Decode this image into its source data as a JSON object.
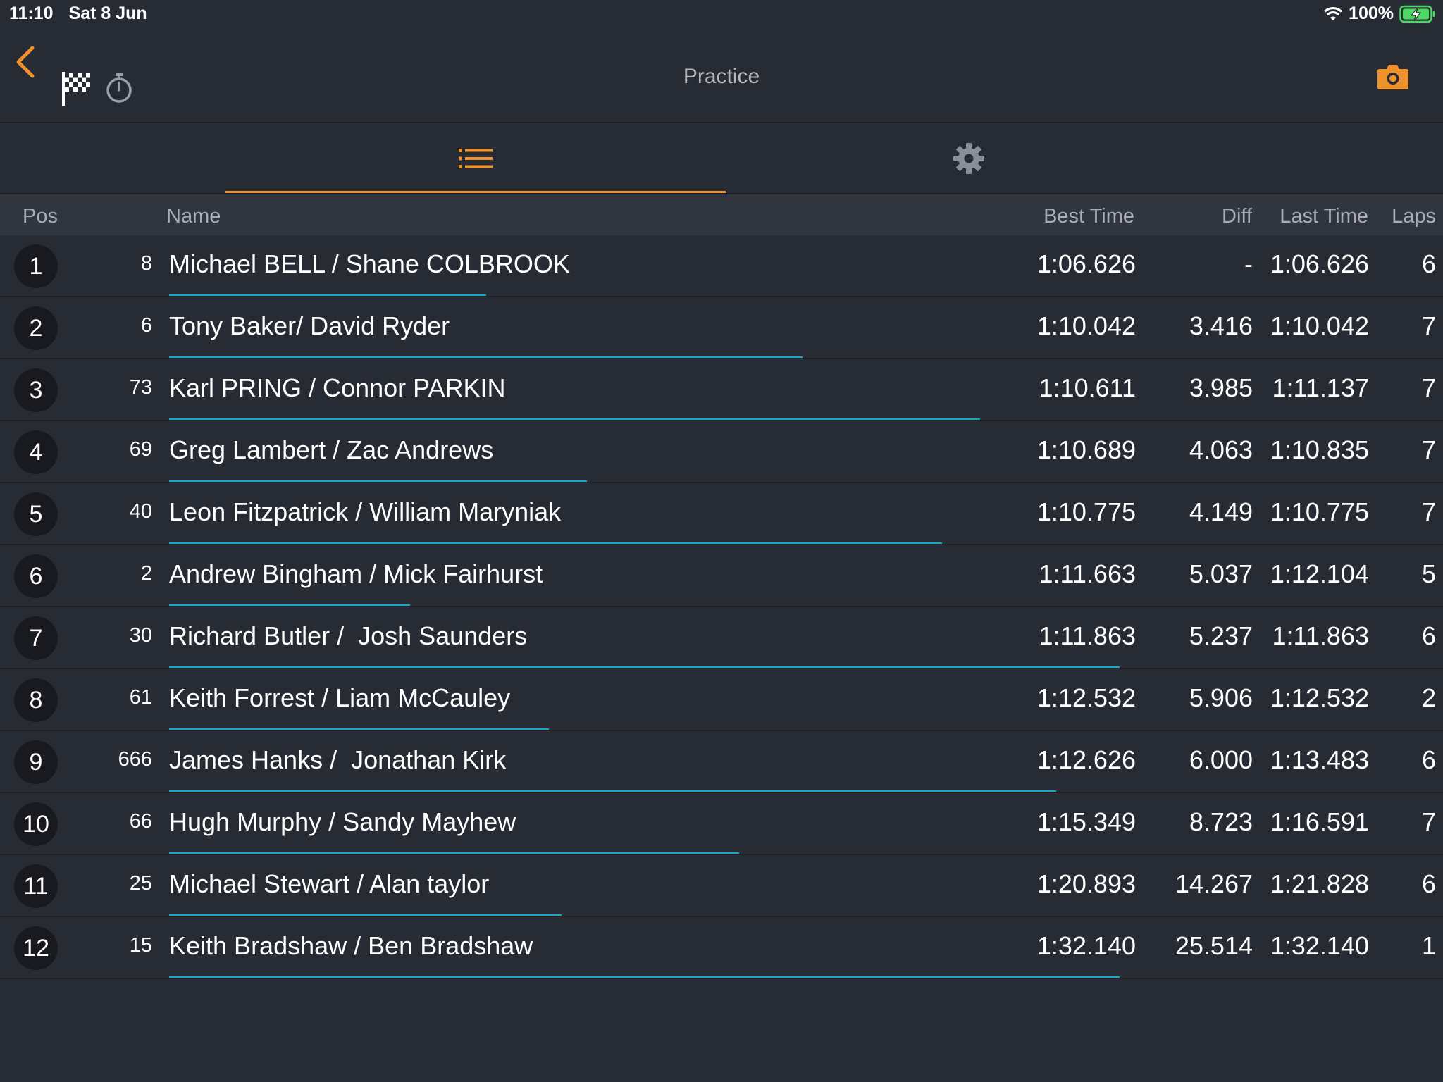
{
  "status_bar": {
    "time": "11:10",
    "date": "Sat 8 Jun",
    "battery": "100%"
  },
  "header": {
    "title": "Practice"
  },
  "colors": {
    "accent": "#f0922b",
    "progress": "#19a6c7",
    "background": "#272b33"
  },
  "icons": {
    "back": "chevron-left-icon",
    "flag": "checkered-flag-icon",
    "stopwatch": "stopwatch-icon",
    "camera": "camera-icon",
    "list": "list-icon",
    "settings": "gear-icon"
  },
  "columns": {
    "pos": "Pos",
    "name": "Name",
    "best_time": "Best Time",
    "diff": "Diff",
    "last_time": "Last Time",
    "laps": "Laps"
  },
  "rows": [
    {
      "pos": "1",
      "car": "8",
      "name": "Michael BELL / Shane COLBROOK",
      "best": "1:06.626",
      "diff": "-",
      "last": "1:06.626",
      "laps": "6",
      "progress": 0.25
    },
    {
      "pos": "2",
      "car": "6",
      "name": "Tony Baker/ David Ryder",
      "best": "1:10.042",
      "diff": "3.416",
      "last": "1:10.042",
      "laps": "7",
      "progress": 0.5
    },
    {
      "pos": "3",
      "car": "73",
      "name": "Karl PRING / Connor PARKIN",
      "best": "1:10.611",
      "diff": "3.985",
      "last": "1:11.137",
      "laps": "7",
      "progress": 0.64
    },
    {
      "pos": "4",
      "car": "69",
      "name": "Greg Lambert / Zac Andrews",
      "best": "1:10.689",
      "diff": "4.063",
      "last": "1:10.835",
      "laps": "7",
      "progress": 0.33
    },
    {
      "pos": "5",
      "car": "40",
      "name": "Leon Fitzpatrick / William Maryniak",
      "best": "1:10.775",
      "diff": "4.149",
      "last": "1:10.775",
      "laps": "7",
      "progress": 0.61
    },
    {
      "pos": "6",
      "car": "2",
      "name": "Andrew Bingham / Mick Fairhurst",
      "best": "1:11.663",
      "diff": "5.037",
      "last": "1:12.104",
      "laps": "5",
      "progress": 0.19
    },
    {
      "pos": "7",
      "car": "30",
      "name": "Richard Butler /  Josh Saunders",
      "best": "1:11.863",
      "diff": "5.237",
      "last": "1:11.863",
      "laps": "6",
      "progress": 0.75
    },
    {
      "pos": "8",
      "car": "61",
      "name": "Keith Forrest / Liam McCauley",
      "best": "1:12.532",
      "diff": "5.906",
      "last": "1:12.532",
      "laps": "2",
      "progress": 0.3
    },
    {
      "pos": "9",
      "car": "666",
      "name": "James Hanks /  Jonathan Kirk",
      "best": "1:12.626",
      "diff": "6.000",
      "last": "1:13.483",
      "laps": "6",
      "progress": 0.7
    },
    {
      "pos": "10",
      "car": "66",
      "name": "Hugh Murphy / Sandy Mayhew",
      "best": "1:15.349",
      "diff": "8.723",
      "last": "1:16.591",
      "laps": "7",
      "progress": 0.45
    },
    {
      "pos": "11",
      "car": "25",
      "name": "Michael Stewart / Alan taylor",
      "best": "1:20.893",
      "diff": "14.267",
      "last": "1:21.828",
      "laps": "6",
      "progress": 0.31
    },
    {
      "pos": "12",
      "car": "15",
      "name": "Keith Bradshaw / Ben Bradshaw",
      "best": "1:32.140",
      "diff": "25.514",
      "last": "1:32.140",
      "laps": "1",
      "progress": 0.75
    }
  ]
}
